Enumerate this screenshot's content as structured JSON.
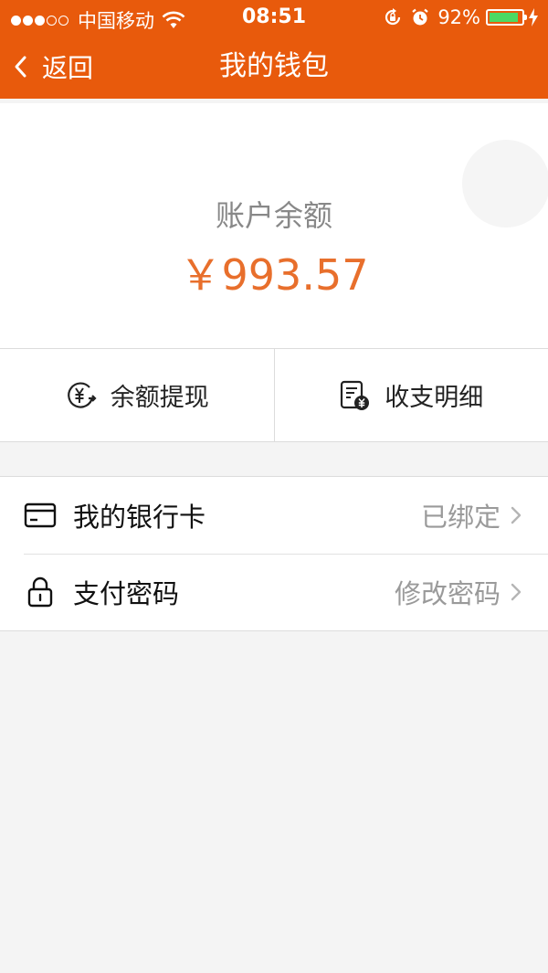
{
  "status_bar": {
    "carrier": "中国移动",
    "time": "08:51",
    "battery_percent": "92%",
    "battery_level": 0.92,
    "signal_bars_filled": 3,
    "signal_bars_total": 5,
    "icons": [
      "wifi-icon",
      "rotation-lock-icon",
      "alarm-icon",
      "battery-icon",
      "charging-icon"
    ]
  },
  "nav": {
    "back_label": "返回",
    "title": "我的钱包",
    "background_color": "#e85a0c"
  },
  "balance": {
    "label": "账户余额",
    "amount": "￥993.57",
    "amount_color": "#e86f2c"
  },
  "actions": [
    {
      "label": "余额提现",
      "icon": "withdraw-yuan-icon"
    },
    {
      "label": "收支明细",
      "icon": "transaction-record-icon"
    }
  ],
  "settings": [
    {
      "label": "我的银行卡",
      "value": "已绑定",
      "icon": "bank-card-icon"
    },
    {
      "label": "支付密码",
      "value": "修改密码",
      "icon": "lock-icon"
    }
  ]
}
